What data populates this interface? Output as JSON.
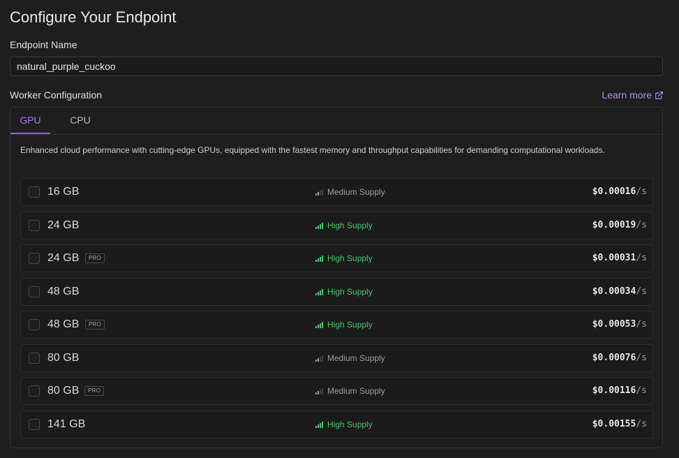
{
  "page": {
    "title": "Configure Your Endpoint"
  },
  "endpoint": {
    "label": "Endpoint Name",
    "value": "natural_purple_cuckoo"
  },
  "worker": {
    "label": "Worker Configuration",
    "learn_more": "Learn more"
  },
  "tabs": [
    {
      "label": "GPU",
      "active": true
    },
    {
      "label": "CPU",
      "active": false
    }
  ],
  "description": "Enhanced cloud performance with cutting-edge GPUs, equipped with the fastest memory and throughput capabilities for demanding computational workloads.",
  "gpus": [
    {
      "memory": "16 GB",
      "pro": false,
      "supply": "Medium Supply",
      "level": "medium",
      "price": "$0.00016",
      "unit": "/s"
    },
    {
      "memory": "24 GB",
      "pro": false,
      "supply": "High Supply",
      "level": "high",
      "price": "$0.00019",
      "unit": "/s"
    },
    {
      "memory": "24 GB",
      "pro": true,
      "pro_label": "PRO",
      "supply": "High Supply",
      "level": "high",
      "price": "$0.00031",
      "unit": "/s"
    },
    {
      "memory": "48 GB",
      "pro": false,
      "supply": "High Supply",
      "level": "high",
      "price": "$0.00034",
      "unit": "/s"
    },
    {
      "memory": "48 GB",
      "pro": true,
      "pro_label": "PRO",
      "supply": "High Supply",
      "level": "high",
      "price": "$0.00053",
      "unit": "/s"
    },
    {
      "memory": "80 GB",
      "pro": false,
      "supply": "Medium Supply",
      "level": "medium",
      "price": "$0.00076",
      "unit": "/s"
    },
    {
      "memory": "80 GB",
      "pro": true,
      "pro_label": "PRO",
      "supply": "Medium Supply",
      "level": "medium",
      "price": "$0.00116",
      "unit": "/s"
    },
    {
      "memory": "141 GB",
      "pro": false,
      "supply": "High Supply",
      "level": "high",
      "price": "$0.00155",
      "unit": "/s"
    }
  ],
  "colors": {
    "accent": "#a77ef0",
    "high": "#4cc56a",
    "medium": "#9e9e9e"
  }
}
